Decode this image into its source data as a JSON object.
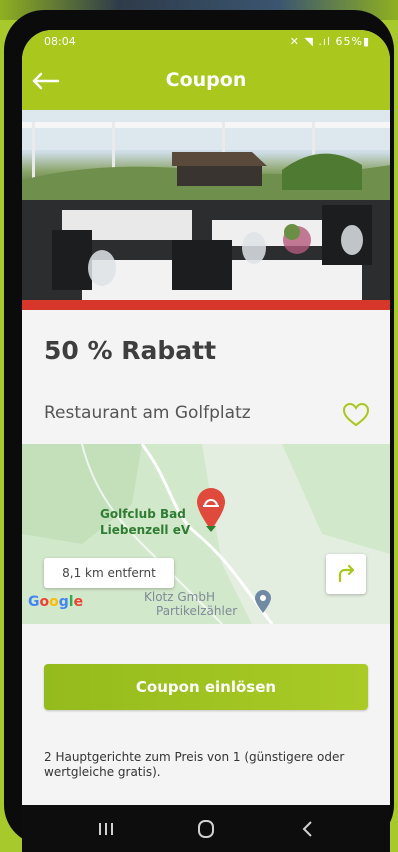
{
  "status_bar": {
    "time": "08:04",
    "icons_text": "✕ ◥ .ıl 65%▮"
  },
  "app_bar": {
    "title": "Coupon"
  },
  "coupon": {
    "discount": "50 % Rabatt",
    "restaurant": "Restaurant am Golfplatz"
  },
  "map": {
    "poi_label_line1": "Golfclub Bad",
    "poi_label_line2": "Liebenzell eV",
    "secondary_label_line1": "Klotz GmbH",
    "secondary_label_line2": "Partikelzähler",
    "distance": "8,1 km entfernt",
    "provider": "Google"
  },
  "actions": {
    "redeem_label": "Coupon einlösen"
  },
  "description": "2 Hauptgerichte zum Preis von 1 (günstigere oder wertgleiche gratis).",
  "colors": {
    "accent": "#a9c71d",
    "highlight_bar": "#d7372b",
    "map_pin": "#e04a3c",
    "heart_outline": "#a9c71d"
  },
  "icons": {
    "back": "arrow-left-icon",
    "favorite": "heart-outline-icon",
    "map_pin": "restaurant-pin-icon",
    "directions": "directions-arrow-icon"
  }
}
